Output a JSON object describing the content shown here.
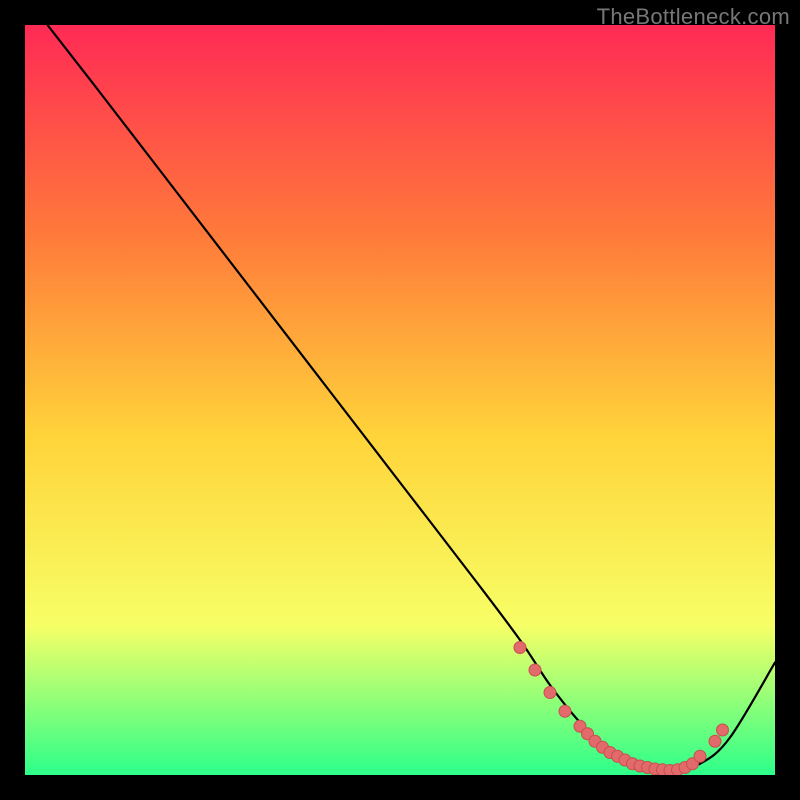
{
  "watermark": "TheBottleneck.com",
  "colors": {
    "background": "#000000",
    "gradient_top": "#ff2a55",
    "gradient_mid_upper": "#ff7a3a",
    "gradient_mid": "#ffd43a",
    "gradient_lower": "#f7ff66",
    "gradient_bottom": "#2cff8a",
    "curve": "#000000",
    "marker_fill": "#e36a6a",
    "marker_stroke": "#c74f4f"
  },
  "chart_data": {
    "type": "line",
    "title": "",
    "xlabel": "",
    "ylabel": "",
    "xlim": [
      0,
      100
    ],
    "ylim": [
      0,
      100
    ],
    "series": [
      {
        "name": "bottleneck-curve",
        "x": [
          3,
          10,
          20,
          30,
          40,
          50,
          60,
          66,
          70,
          74,
          78,
          82,
          86,
          90,
          94,
          100
        ],
        "y": [
          100,
          91,
          78,
          65,
          52,
          39,
          26,
          18,
          12,
          7,
          3,
          1,
          0.5,
          1.5,
          5,
          15
        ]
      }
    ],
    "markers": {
      "name": "highlight-dots",
      "x": [
        66,
        68,
        70,
        72,
        74,
        75,
        76,
        77,
        78,
        79,
        80,
        81,
        82,
        83,
        84,
        85,
        86,
        87,
        88,
        89,
        90,
        92,
        93
      ],
      "y": [
        17,
        14,
        11,
        8.5,
        6.5,
        5.5,
        4.5,
        3.7,
        3,
        2.5,
        2,
        1.5,
        1.2,
        1,
        0.8,
        0.7,
        0.6,
        0.7,
        1,
        1.5,
        2.5,
        4.5,
        6
      ]
    }
  }
}
